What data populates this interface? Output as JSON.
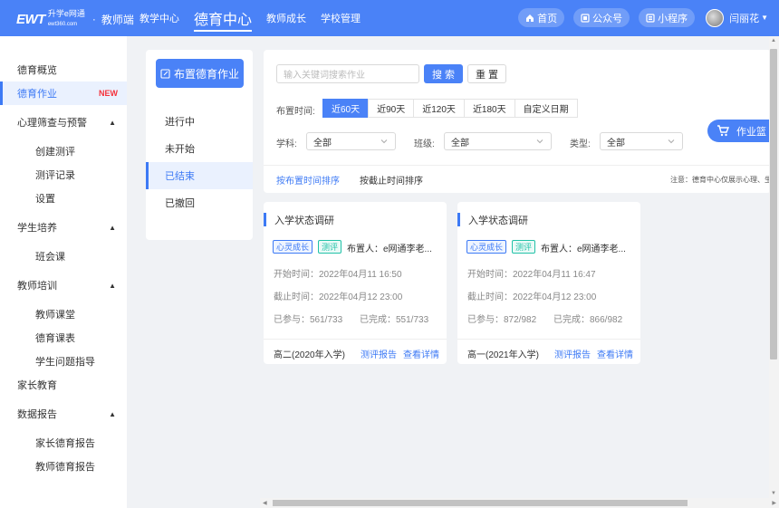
{
  "header": {
    "logo_text": "EWT",
    "logo_sub": "升学e网通",
    "logo_site": "ewt360.com",
    "portal": "教师端",
    "nav": [
      {
        "label": "教学中心"
      },
      {
        "label": "德育中心"
      },
      {
        "label": "教师成长"
      },
      {
        "label": "学校管理"
      }
    ],
    "active_nav": "德育中心",
    "links": {
      "home": "首页",
      "official": "公众号",
      "miniapp": "小程序"
    },
    "user_name": "闫丽花",
    "user_caret": "▼"
  },
  "sidebar": {
    "items": [
      {
        "label": "德育概览"
      },
      {
        "label": "德育作业",
        "badge": "NEW"
      },
      {
        "label": "心理筛查与预警",
        "caret": "▲"
      },
      {
        "label": "创建测评"
      },
      {
        "label": "测评记录"
      },
      {
        "label": "设置"
      },
      {
        "label": "学生培养",
        "caret": "▲"
      },
      {
        "label": "班会课"
      },
      {
        "label": "教师培训",
        "caret": "▲"
      },
      {
        "label": "教师课堂"
      },
      {
        "label": "德育课表"
      },
      {
        "label": "学生问题指导"
      },
      {
        "label": "家长教育"
      },
      {
        "label": "数据报告",
        "caret": "▲"
      },
      {
        "label": "家长德育报告"
      },
      {
        "label": "教师德育报告"
      }
    ]
  },
  "status_panel": {
    "assign_label": "布置德育作业",
    "items": [
      {
        "label": "进行中"
      },
      {
        "label": "未开始"
      },
      {
        "label": "已结束"
      },
      {
        "label": "已撤回"
      }
    ],
    "active": "已结束"
  },
  "filters": {
    "search_placeholder": "输入关键词搜索作业",
    "search_label": "搜 索",
    "reset_label": "重 置",
    "time_label": "布置时间:",
    "time_options": [
      {
        "label": "近60天"
      },
      {
        "label": "近90天"
      },
      {
        "label": "近120天"
      },
      {
        "label": "近180天"
      },
      {
        "label": "自定义日期"
      }
    ],
    "active_time": "近60天",
    "subject_label": "学科:",
    "subject_value": "全部",
    "class_label": "班级:",
    "class_value": "全部",
    "type_label": "类型:",
    "type_value": "全部",
    "sort_by_assign": "按布置时间排序",
    "sort_by_deadline": "按截止时间排序",
    "notice": "注意：德育中心仅展示心理、生"
  },
  "cards": [
    {
      "title": "入学状态调研",
      "tag1": "心灵成长",
      "tag2": "测评",
      "publisher": "布置人：e网通李老...",
      "start": "开始时间：2022年04月11 16:50",
      "end": "截止时间：2022年04月12 23:00",
      "joined": "已参与：561/733",
      "completed": "已完成：551/733",
      "grade": "高二(2020年入学)",
      "report_link": "测评报告",
      "detail_link": "查看详情"
    },
    {
      "title": "入学状态调研",
      "tag1": "心灵成长",
      "tag2": "测评",
      "publisher": "布置人：e网通李老...",
      "start": "开始时间：2022年04月11 16:47",
      "end": "截止时间：2022年04月12 23:00",
      "joined": "已参与：872/982",
      "completed": "已完成：866/982",
      "grade": "高一(2021年入学)",
      "report_link": "测评报告",
      "detail_link": "查看详情"
    }
  ],
  "basket_label": "作业篮",
  "colors": {
    "primary": "#4a82f7",
    "accent": "#3d7af5",
    "badge": "#f5323c",
    "tag_green": "#22c2a8"
  },
  "icons": [
    "home-icon",
    "wechat-icon",
    "miniapp-icon",
    "edit-icon",
    "chevron-down-icon",
    "cart-icon"
  ]
}
